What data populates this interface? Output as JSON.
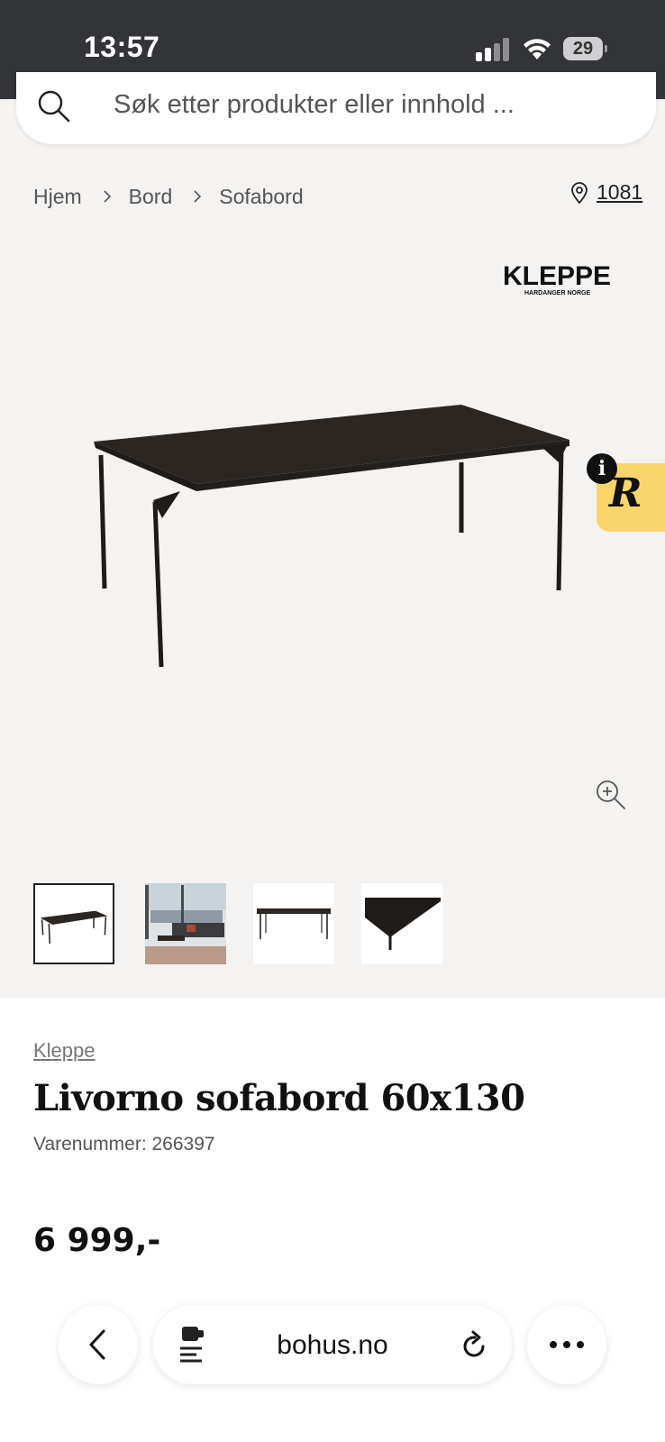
{
  "status_bar": {
    "time": "13:57",
    "battery": "29",
    "icons": [
      "signal-icon",
      "wifi-icon",
      "battery-icon"
    ]
  },
  "search": {
    "placeholder": "Søk etter produkter eller innhold ..."
  },
  "breadcrumb": {
    "items": [
      "Hjem",
      "Bord",
      "Sofabord"
    ]
  },
  "store": {
    "number": "1081"
  },
  "product": {
    "brand_logo_text": "KLEPPE",
    "brand_logo_sub": "HARDANGER NORGE",
    "brand": "Kleppe",
    "title": "Livorno sofabord 60x130",
    "sku": "Varenummer: 266397",
    "price": "6 999,-",
    "thumbnail_count": 4,
    "selected_thumbnail": 0
  },
  "browser": {
    "url": "bohus.no"
  },
  "colors": {
    "status_bar_bg": "#333438",
    "page_bg": "#f5f3f1",
    "badge_yellow": "#fad56b",
    "table_dark": "#2b2622"
  }
}
